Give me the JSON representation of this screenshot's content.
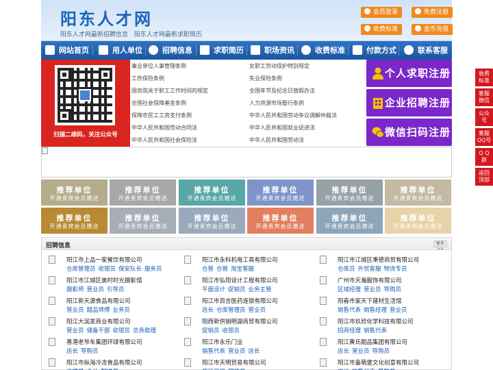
{
  "header": {
    "site_title": "阳东人才网",
    "sub_links": [
      "阳东人才网最新招聘信息",
      "阳东人才网最新求职简历"
    ],
    "buttons": {
      "login": "会员登录",
      "register": "免费注册",
      "fee": "收费标准",
      "coin": "金币充值"
    }
  },
  "nav": [
    {
      "label": "网站首页",
      "icon": "home-icon"
    },
    {
      "label": "用人单位",
      "icon": "building-icon"
    },
    {
      "label": "招聘信息",
      "icon": "chat-icon"
    },
    {
      "label": "求职简历",
      "icon": "resume-icon"
    },
    {
      "label": "职场资讯",
      "icon": "news-icon"
    },
    {
      "label": "收费标准",
      "icon": "fee-icon"
    },
    {
      "label": "付款方式",
      "icon": "card-icon"
    },
    {
      "label": "联系客服",
      "icon": "phone-icon"
    }
  ],
  "qr": {
    "caption": "扫描二维码，关注公众号"
  },
  "links": {
    "left": [
      "事业单位人事管理条例",
      "工伤保险条例",
      "国务院关于职工工作时间的规定",
      "全国社会保障基金条例",
      "保障农民工工资支付条例",
      "中华人民共和国劳动合同法",
      "中华人民共和国社会保险法"
    ],
    "right": [
      "女职工劳动保护特别规定",
      "失业保险条例",
      "全国年节及纪念日放假办法",
      "人力资源市场暂行条例",
      "中华人民共和国劳动争议调解仲裁法",
      "中华人民共和国就业促进法",
      "中华人民共和国劳动法"
    ]
  },
  "register_buttons": [
    {
      "label": "个人求职注册",
      "icon": "person-icon"
    },
    {
      "label": "企业招聘注册",
      "icon": "enterprise-icon"
    },
    {
      "label": "微信扫码注册",
      "icon": "wechat-icon"
    }
  ],
  "recommend": {
    "title": "推荐单位",
    "subtitle": "开通贵宾会员赠送",
    "colors": [
      "#b4ac8b",
      "#a8a8a8",
      "#57a8a6",
      "#7d95c9",
      "#97a1a8",
      "#c4b9a3",
      "#b88a33",
      "#a8aeb6",
      "#9aa9bb",
      "#e27f5f",
      "#8ea5b8",
      "#e8d2a8"
    ]
  },
  "jobs": {
    "title": "招聘信息",
    "more": "更多>>",
    "columns": [
      [
        {
          "company": "阳江市上品一家餐饮有限公司",
          "positions": [
            "仓库管理员",
            "收银员",
            "保安队长",
            "服务员"
          ]
        },
        {
          "company": "阳江市江城区美时时光摄影馆",
          "positions": [
            "摄影师",
            "营业员",
            "引导员"
          ]
        },
        {
          "company": "阳江新天源食品有限公司",
          "positions": [
            "营业员",
            "甜品师傅",
            "业务员"
          ]
        },
        {
          "company": "阳江大润发商业有限公司",
          "positions": [
            "营业员",
            "储备干部",
            "收银员",
            "总务助理"
          ]
        },
        {
          "company": "香港老爷车集团环球有限公司",
          "positions": [
            "店长",
            "导购员"
          ]
        },
        {
          "company": "阳江市纵海冷冻食品有限公司",
          "positions": [
            "收银员",
            "会计",
            "配送员"
          ]
        }
      ],
      [
        {
          "company": "阳江市永科机电工具有限公司",
          "positions": [
            "仓管",
            "仓管",
            "淘宝客服"
          ]
        },
        {
          "company": "阳江市弘阳设计工程有限公司",
          "positions": [
            "平面设计",
            "促销员",
            "业务主管"
          ]
        },
        {
          "company": "阳江市百合医药连锁有限公司",
          "positions": [
            "店长",
            "仓库管理员",
            "营业员"
          ]
        },
        {
          "company": "阳西新供销明湖商贸有限公司",
          "positions": [
            "促销员",
            "收银员"
          ]
        },
        {
          "company": "阳江市永乐门业",
          "positions": [
            "销售代表",
            "营业员",
            "店长"
          ]
        },
        {
          "company": "阳江市天明贸易有限公司",
          "positions": [
            "货运司机",
            "理货员"
          ]
        }
      ],
      [
        {
          "company": "阳江市江城区秉德商贸有限公司",
          "positions": [
            "仓库员",
            "外贸客服",
            "物流专员"
          ]
        },
        {
          "company": "广州市天瀚服饰有限公司",
          "positions": [
            "区域经理",
            "营业员",
            "导购员"
          ]
        },
        {
          "company": "阳春市家天下建材生活馆",
          "positions": [
            "销售代表",
            "销售经理",
            "营业员"
          ]
        },
        {
          "company": "阳江市玖欣化学科技有限公司",
          "positions": [
            "招商经理",
            "销售代表"
          ]
        },
        {
          "company": "阳江黄氏甜品集团有限公司",
          "positions": [
            "店长",
            "营业员",
            "导购员"
          ]
        },
        {
          "company": "阳江市童萌堡文化创意有限公司",
          "positions": [
            "店长",
            "销售代表",
            "导购员"
          ]
        }
      ]
    ]
  },
  "float_bar": [
    {
      "lines": [
        "收费",
        "标准"
      ]
    },
    {
      "lines": [
        "客服",
        "微信"
      ]
    },
    {
      "lines": [
        "公众",
        "号"
      ]
    },
    {
      "lines": [
        "客服",
        "QQ号"
      ]
    },
    {
      "lines": [
        "Q Q",
        "群"
      ]
    },
    {
      "lines": [
        "返回",
        "顶部"
      ]
    }
  ]
}
